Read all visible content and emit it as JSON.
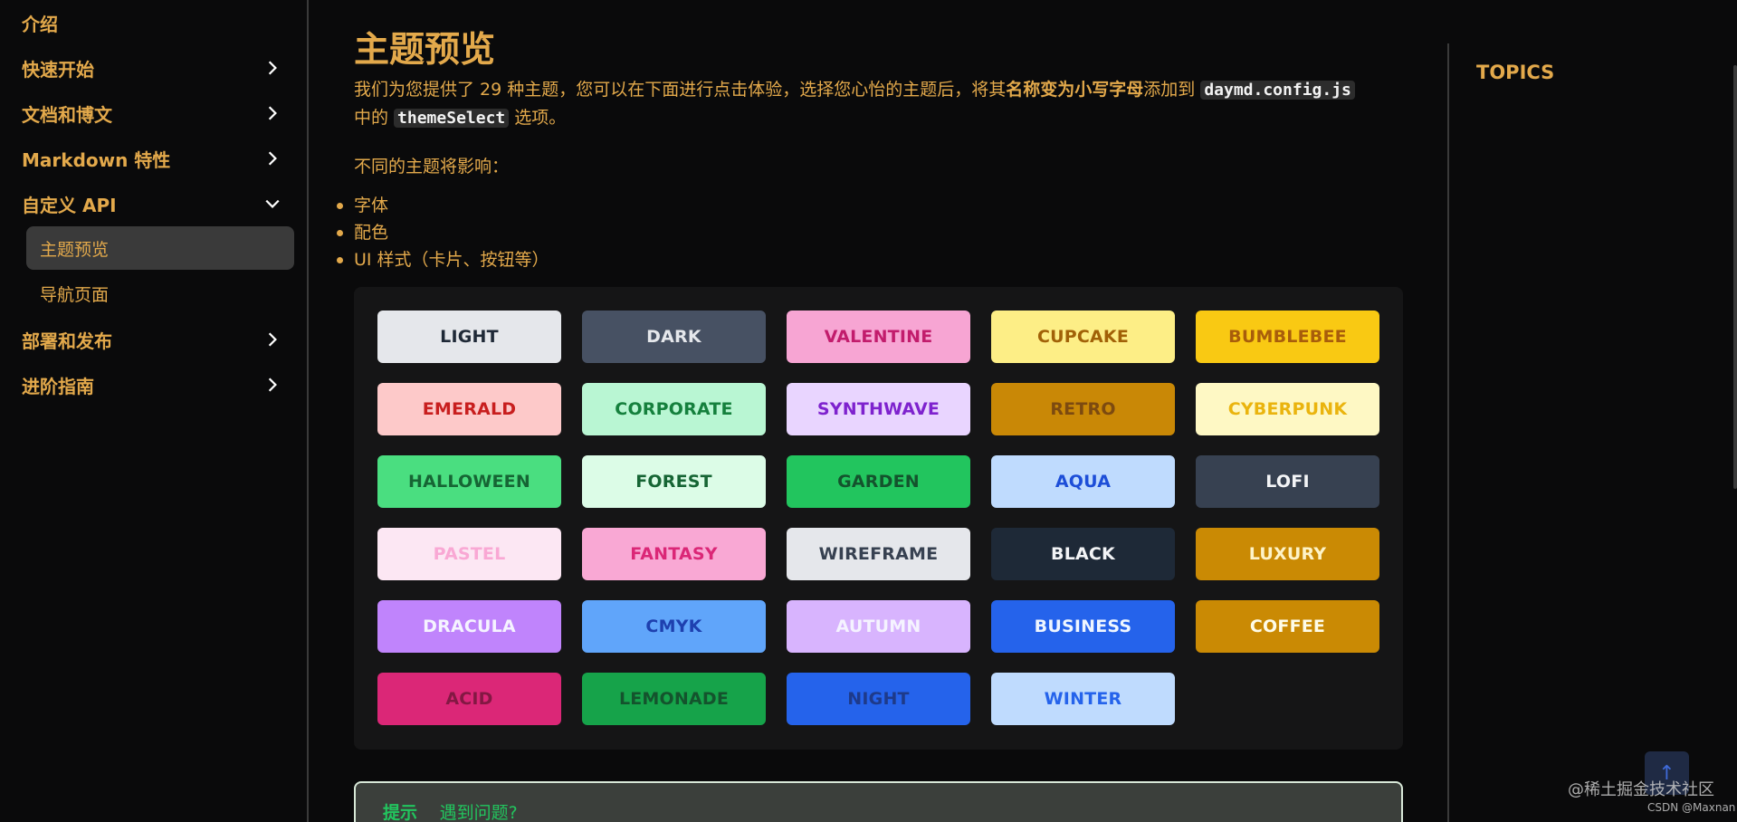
{
  "sidebar": {
    "items": [
      {
        "label": "介绍",
        "has_chevron": false
      },
      {
        "label": "快速开始",
        "has_chevron": true
      },
      {
        "label": "文档和博文",
        "has_chevron": true
      },
      {
        "label": "Markdown 特性",
        "has_chevron": true
      },
      {
        "label": "自定义 API",
        "has_chevron": true,
        "expanded": true
      },
      {
        "label": "部署和发布",
        "has_chevron": true
      },
      {
        "label": "进阶指南",
        "has_chevron": true
      }
    ],
    "sub_items": [
      {
        "label": "主题预览",
        "active": true
      },
      {
        "label": "导航页面",
        "active": false
      }
    ]
  },
  "main": {
    "title": "主题预览",
    "intro_part1": "我们为您提供了 29 种主题，您可以在下面进行点击体验，选择您心怡的主题后，将其",
    "intro_bold": "名称变为小写字母",
    "intro_part2": "添加到 ",
    "intro_code1": "daymd.config.js",
    "intro_part3": "中的 ",
    "intro_code2": "themeSelect",
    "intro_part4": " 选项。",
    "para": "不同的主题将影响：",
    "list": [
      "字体",
      "配色",
      "UI 样式（卡片、按钮等）"
    ],
    "themes": [
      {
        "label": "LIGHT",
        "bg": "#e5e7eb",
        "fg": "#1f2937"
      },
      {
        "label": "DARK",
        "bg": "#475163",
        "fg": "#e5e7eb"
      },
      {
        "label": "VALENTINE",
        "bg": "#f7a5d3",
        "fg": "#c21c6c"
      },
      {
        "label": "CUPCAKE",
        "bg": "#fdee86",
        "fg": "#a16107"
      },
      {
        "label": "BUMBLEBEE",
        "bg": "#f9c913",
        "fg": "#a85d0b"
      },
      {
        "label": "EMERALD",
        "bg": "#fdc9c9",
        "fg": "#c81e1e"
      },
      {
        "label": "CORPORATE",
        "bg": "#b9f6d3",
        "fg": "#15803d"
      },
      {
        "label": "SYNTHWAVE",
        "bg": "#e9d5ff",
        "fg": "#7e22ce"
      },
      {
        "label": "RETRO",
        "bg": "#c98806",
        "fg": "#7c4a10"
      },
      {
        "label": "CYBERPUNK",
        "bg": "#fef8c4",
        "fg": "#eab40e"
      },
      {
        "label": "HALLOWEEN",
        "bg": "#4ade80",
        "fg": "#166534"
      },
      {
        "label": "FOREST",
        "bg": "#dcfce7",
        "fg": "#166534"
      },
      {
        "label": "GARDEN",
        "bg": "#22c55e",
        "fg": "#14532d"
      },
      {
        "label": "AQUA",
        "bg": "#bfdbfe",
        "fg": "#1d4ed8"
      },
      {
        "label": "LOFI",
        "bg": "#374151",
        "fg": "#f3f4f6"
      },
      {
        "label": "PASTEL",
        "bg": "#fce7f3",
        "fg": "#f9a8d4"
      },
      {
        "label": "FANTASY",
        "bg": "#f9a8d4",
        "fg": "#db2777"
      },
      {
        "label": "WIREFRAME",
        "bg": "#e5e7eb",
        "fg": "#374151"
      },
      {
        "label": "BLACK",
        "bg": "#1e2937",
        "fg": "#f3f4f6"
      },
      {
        "label": "LUXURY",
        "bg": "#ca8a04",
        "fg": "#fef3c7"
      },
      {
        "label": "DRACULA",
        "bg": "#c084fc",
        "fg": "#f5f3ff"
      },
      {
        "label": "CMYK",
        "bg": "#60a5fa",
        "fg": "#1e40af"
      },
      {
        "label": "AUTUMN",
        "bg": "#d8b4fe",
        "fg": "#f5f3ff"
      },
      {
        "label": "BUSINESS",
        "bg": "#2563eb",
        "fg": "#eff6ff"
      },
      {
        "label": "COFFEE",
        "bg": "#ca8a04",
        "fg": "#fefce8"
      },
      {
        "label": "ACID",
        "bg": "#db2777",
        "fg": "#831843"
      },
      {
        "label": "LEMONADE",
        "bg": "#16a34a",
        "fg": "#14532d"
      },
      {
        "label": "NIGHT",
        "bg": "#2563eb",
        "fg": "#1e3a8a"
      },
      {
        "label": "WINTER",
        "bg": "#bfdbfe",
        "fg": "#2563eb"
      }
    ],
    "tip_title": "提示",
    "tip_text": "遇到问题?"
  },
  "topics_label": "TOPICS",
  "backtop_icon": "↑",
  "watermark": "@稀土掘金技术社区",
  "watermark_small": "CSDN @Maxnan"
}
